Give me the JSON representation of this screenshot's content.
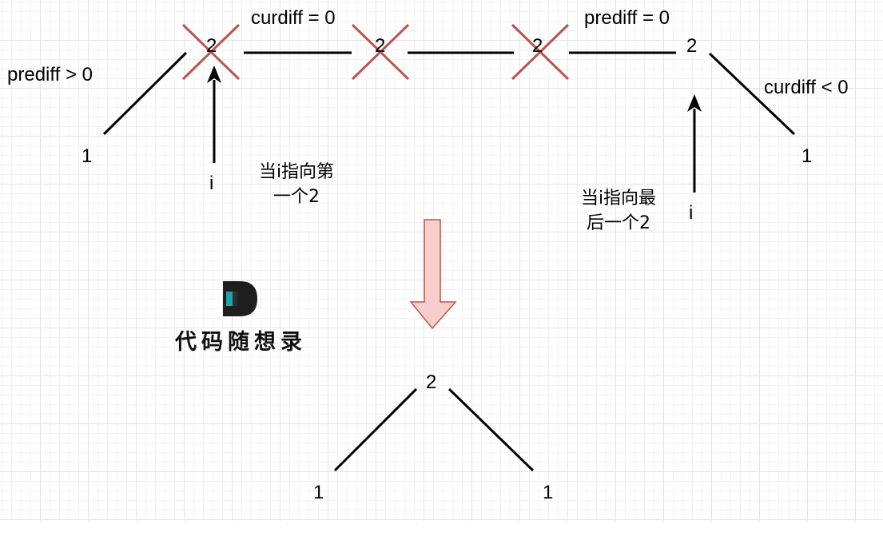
{
  "top_row": {
    "left_one": "1",
    "twos": [
      "2",
      "2",
      "2",
      "2"
    ],
    "right_one": "1"
  },
  "labels": {
    "prediff_gt0": "prediff > 0",
    "curdiff_eq0": "curdiff = 0",
    "prediff_eq0": "prediff = 0",
    "curdiff_lt0": "curdiff < 0"
  },
  "pointers": {
    "first": {
      "index": "i",
      "note_line1": "当i指向第",
      "note_line2": "一个2"
    },
    "last": {
      "index": "i",
      "note_line1": "当i指向最",
      "note_line2": "后一个2"
    }
  },
  "result": {
    "peak": "2",
    "left": "1",
    "right": "1"
  },
  "logo": {
    "text": "代码随想录"
  },
  "colors": {
    "line": "#000000",
    "cross": "#b85450",
    "down_arrow_fill": "#f8cecc",
    "down_arrow_stroke": "#b85450",
    "logo_dark": "#1e1e1e",
    "logo_accent": "#1fa2ae"
  }
}
